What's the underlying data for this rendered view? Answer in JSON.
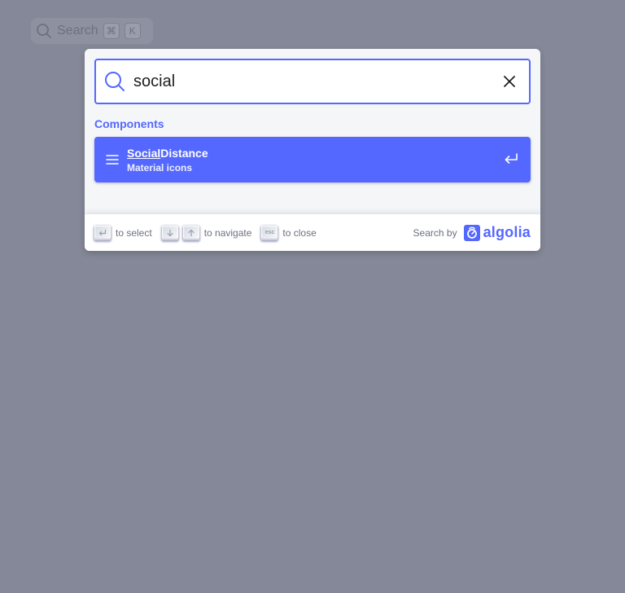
{
  "background_search": {
    "label": "Search",
    "keys": [
      "⌘",
      "K"
    ]
  },
  "search": {
    "query": "social"
  },
  "results": {
    "section_title": "Components",
    "hits": [
      {
        "title_highlight": "Social",
        "title_rest": "Distance",
        "path": "Material icons"
      }
    ]
  },
  "footer": {
    "select_label": "to select",
    "navigate_label": "to navigate",
    "close_label": "to close",
    "esc_key": "esc",
    "search_by": "Search by",
    "brand": "algolia"
  },
  "colors": {
    "accent": "#5468ff",
    "overlay": "#858898",
    "modal_bg": "#f5f6f7",
    "muted_text": "#6c7080"
  },
  "icons": [
    "search-icon",
    "close-icon",
    "menu-lines-icon",
    "enter-icon",
    "arrow-down-icon",
    "arrow-up-icon",
    "algolia-logo-icon"
  ]
}
